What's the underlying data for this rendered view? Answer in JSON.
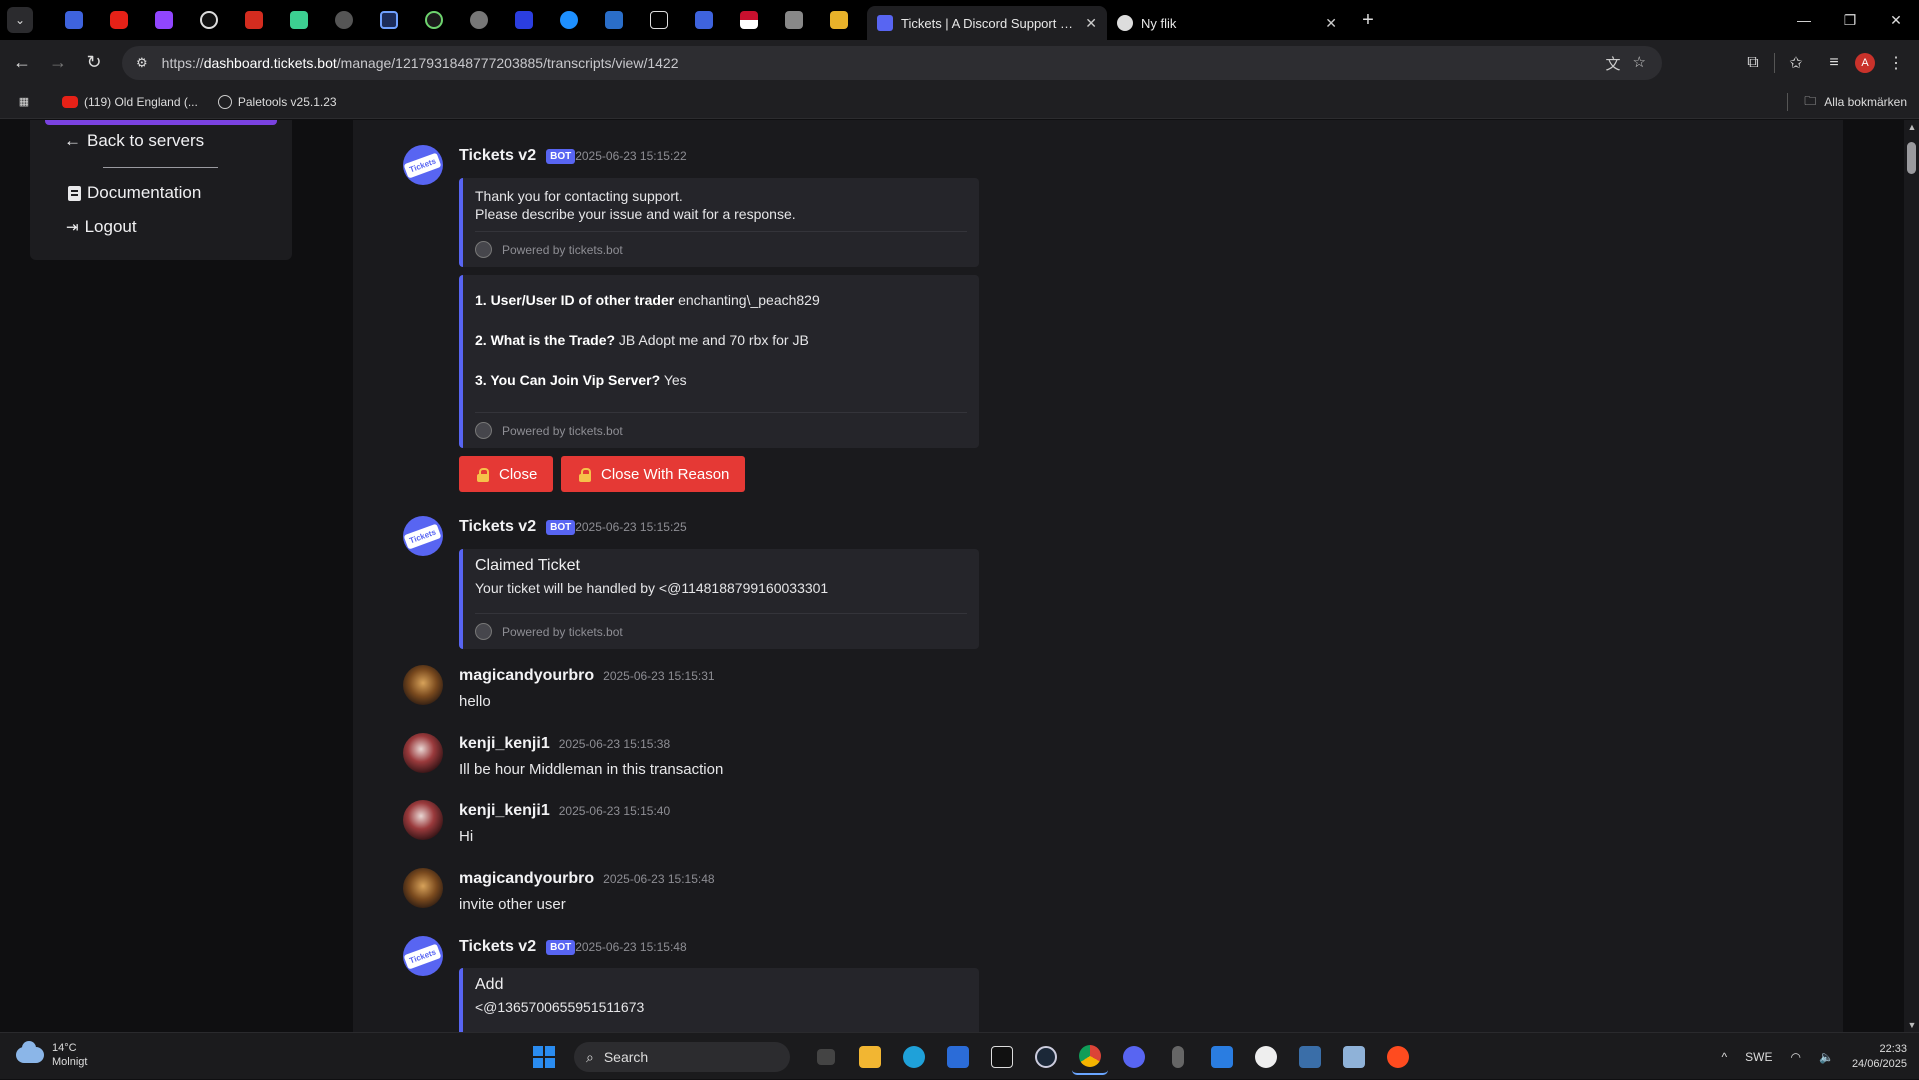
{
  "browser": {
    "active_tab_title": "Tickets | A Discord Support Manager",
    "second_tab_title": "Ny flik",
    "url_prefix": "https://",
    "url_host": "dashboard.tickets.bot",
    "url_path": "/manage/1217931848777203885/transcripts/view/1422",
    "bookmarks": [
      {
        "label": "(119) Old England (..."
      },
      {
        "label": "Paletools v25.1.23"
      }
    ],
    "all_bookmarks_label": "Alla bokmärken",
    "profile_initial": "A"
  },
  "sidebar": {
    "back_label": "Back to servers",
    "documentation_label": "Documentation",
    "logout_label": "Logout"
  },
  "colors": {
    "accent": "#7a42e0",
    "embed_border": "#5865f2",
    "danger": "#e53935"
  },
  "messages": [
    {
      "author": "Tickets v2",
      "badge": "BOT",
      "time": "2025-06-23 15:15:22",
      "embed1": {
        "line1": "Thank you for contacting support.",
        "line2": "Please describe your issue and wait for a response.",
        "footer": "Powered by tickets.bot"
      },
      "embed2": {
        "f1_label": "1. User/User ID of other trader",
        "f1_value": "enchanting\\_peach829",
        "f2_label": "2. What is the Trade?",
        "f2_value": "JB Adopt me and 70 rbx for JB",
        "f3_label": "3. You Can Join Vip Server?",
        "f3_value": "Yes",
        "footer": "Powered by tickets.bot"
      },
      "buttons": {
        "close": "Close",
        "close_reason": "Close With Reason"
      }
    },
    {
      "author": "Tickets v2",
      "badge": "BOT",
      "time": "2025-06-23 15:15:25",
      "embed": {
        "title": "Claimed Ticket",
        "desc": "Your ticket will be handled by <@1148188799160033301",
        "footer": "Powered by tickets.bot"
      }
    },
    {
      "author": "magicandyourbro",
      "time": "2025-06-23 15:15:31",
      "text": "hello"
    },
    {
      "author": "kenji_kenji1",
      "time": "2025-06-23 15:15:38",
      "text": "Ill be hour Middleman in this transaction"
    },
    {
      "author": "kenji_kenji1",
      "time": "2025-06-23 15:15:40",
      "text": "Hi"
    },
    {
      "author": "magicandyourbro",
      "time": "2025-06-23 15:15:48",
      "text": "invite other user"
    },
    {
      "author": "Tickets v2",
      "badge": "BOT",
      "time": "2025-06-23 15:15:48",
      "embed": {
        "title": "Add",
        "desc": "<@1365700655951511673"
      }
    }
  ],
  "taskbar": {
    "temperature": "14°C",
    "weather": "Molnigt",
    "search_placeholder": "Search",
    "language": "SWE",
    "time": "22:33",
    "date": "24/06/2025"
  }
}
